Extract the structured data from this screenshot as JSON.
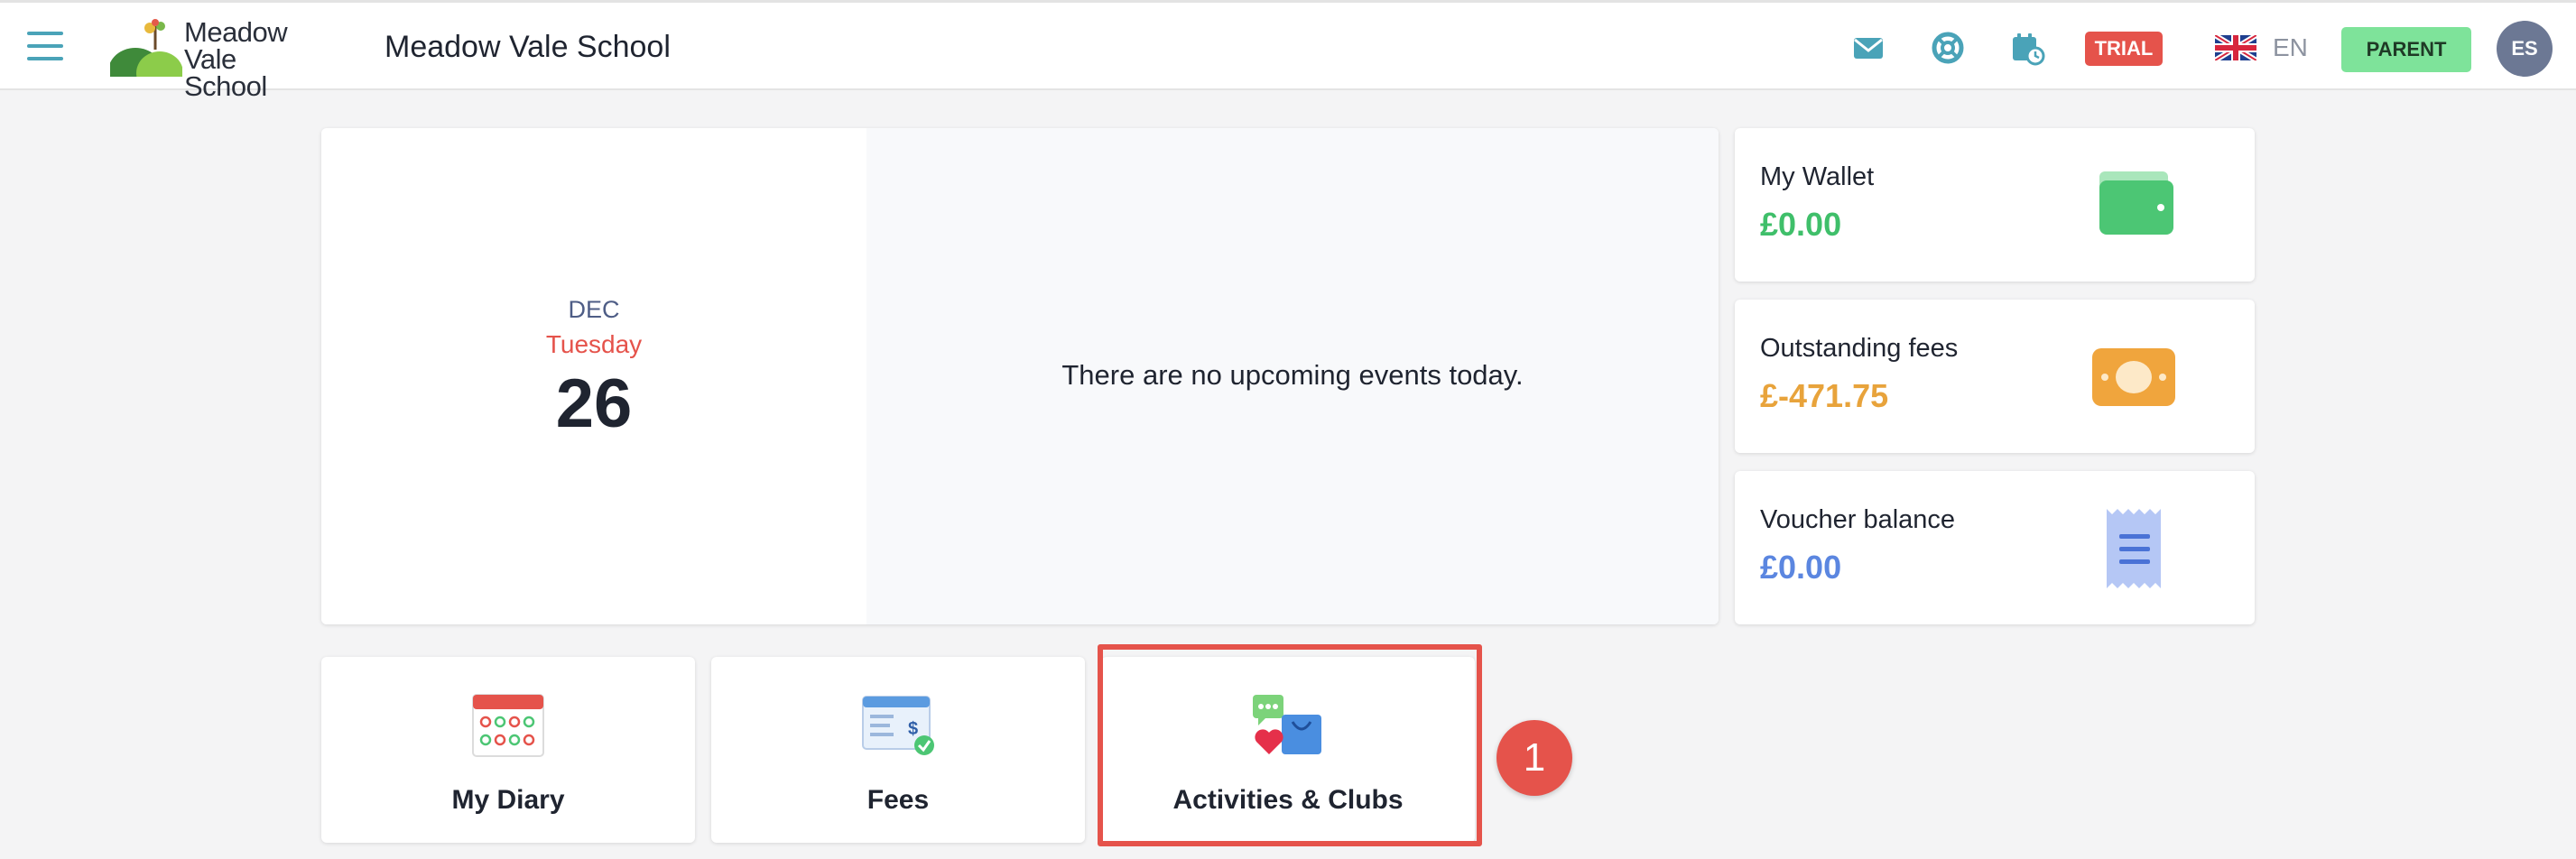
{
  "header": {
    "logo_text_line1": "Meadow",
    "logo_text_line2": "Vale School",
    "school_name": "Meadow Vale School",
    "trial_label": "TRIAL",
    "language": "EN",
    "role_button": "PARENT",
    "user_initials": "ES",
    "icons": [
      "menu-icon",
      "mail-icon",
      "support-lifebuoy-icon",
      "calendar-clock-icon",
      "uk-flag-icon"
    ]
  },
  "calendar": {
    "month": "DEC",
    "weekday": "Tuesday",
    "day": "26",
    "no_events_message": "There are no upcoming events today."
  },
  "balances": [
    {
      "label": "My Wallet",
      "value": "£0.00",
      "color": "#3fbf6a",
      "icon": "wallet-icon"
    },
    {
      "label": "Outstanding fees",
      "value": "£-471.75",
      "color": "#e8a33b",
      "icon": "banknote-icon"
    },
    {
      "label": "Voucher balance",
      "value": "£0.00",
      "color": "#5b86e0",
      "icon": "receipt-icon"
    }
  ],
  "tiles": [
    {
      "label": "My Diary",
      "icon": "diary-calendar-icon"
    },
    {
      "label": "Fees",
      "icon": "fees-invoice-icon"
    },
    {
      "label": "Activities & Clubs",
      "icon": "activities-shopping-bag-icon"
    }
  ],
  "annotation": {
    "step_number": "1",
    "color": "#e5534b"
  }
}
